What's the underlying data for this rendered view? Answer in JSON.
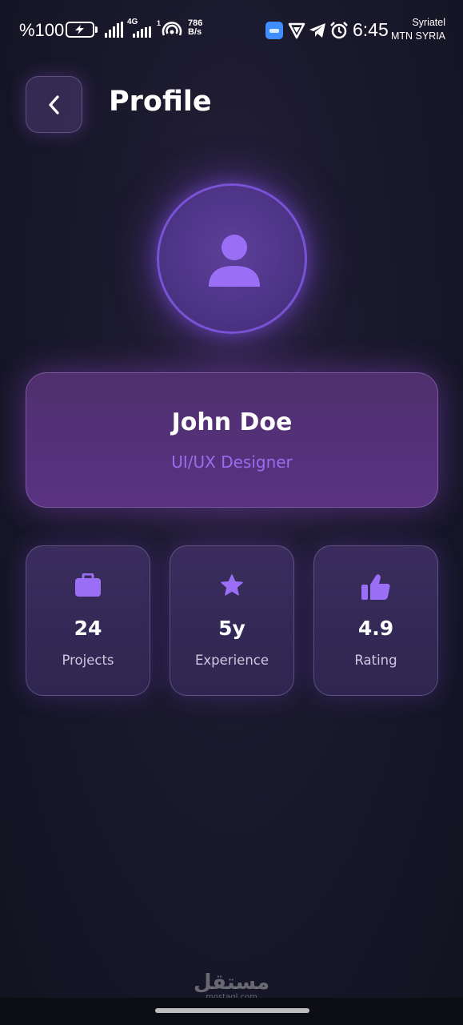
{
  "status_bar": {
    "battery": "%100",
    "network": "4G",
    "sim_slot": "1",
    "speed_value": "786",
    "speed_unit": "B/s",
    "time": "6:45",
    "carrier_1": "Syriatel",
    "carrier_2": "MTN SYRIA",
    "icons": [
      "battery-charging-icon",
      "signal-icon",
      "hotspot-icon",
      "app-icon",
      "vpn-icon",
      "telegram-icon",
      "alarm-icon"
    ]
  },
  "header": {
    "back_icon": "chevron-left-icon",
    "title": "Profile"
  },
  "profile": {
    "avatar_icon": "person-icon",
    "name": "John Doe",
    "role": "UI/UX Designer"
  },
  "stats": [
    {
      "icon": "briefcase-icon",
      "value": "24",
      "label": "Projects"
    },
    {
      "icon": "star-icon",
      "value": "5y",
      "label": "Experience"
    },
    {
      "icon": "thumbs-up-icon",
      "value": "4.9",
      "label": "Rating"
    }
  ],
  "watermark": {
    "logo": "مستقل",
    "url": "mostaql.com"
  },
  "colors": {
    "accent": "#8b5cf6",
    "role_text": "#9a6cf0",
    "background": "#161627"
  }
}
